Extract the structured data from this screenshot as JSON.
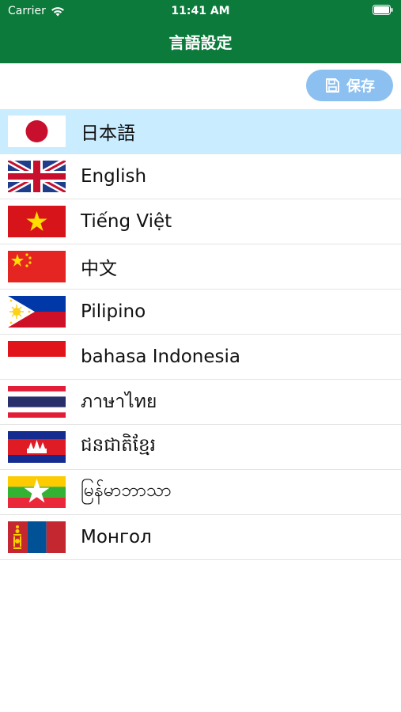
{
  "status_bar": {
    "carrier": "Carrier",
    "time": "11:41 AM"
  },
  "header": {
    "title": "言語設定"
  },
  "toolbar": {
    "save_label": "保存"
  },
  "colors": {
    "header_green": "#0b7a3a",
    "selected_row": "#c9ecff",
    "save_button": "#8cc0f0"
  },
  "languages": [
    {
      "label": "日本語",
      "flag": "japan-flag-icon",
      "selected": true
    },
    {
      "label": "English",
      "flag": "uk-flag-icon",
      "selected": false
    },
    {
      "label": "Tiếng Việt",
      "flag": "vietnam-flag-icon",
      "selected": false
    },
    {
      "label": "中文",
      "flag": "china-flag-icon",
      "selected": false
    },
    {
      "label": "Pilipino",
      "flag": "philippines-flag-icon",
      "selected": false
    },
    {
      "label": "bahasa Indonesia",
      "flag": "indonesia-flag-icon",
      "selected": false
    },
    {
      "label": "ภาษาไทย",
      "flag": "thailand-flag-icon",
      "selected": false
    },
    {
      "label": "ជនជាតិខ្មែរ",
      "flag": "cambodia-flag-icon",
      "selected": false
    },
    {
      "label": "မြန်မာဘာသာ",
      "flag": "myanmar-flag-icon",
      "selected": false
    },
    {
      "label": "Монгол",
      "flag": "mongolia-flag-icon",
      "selected": false
    }
  ]
}
